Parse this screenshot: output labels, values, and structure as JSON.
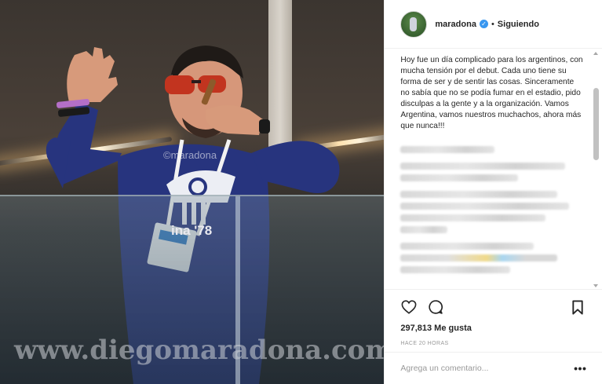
{
  "post": {
    "photo": {
      "alt": "",
      "watermark_handle": "©maradona",
      "watermark_site": "www.diegomaradona.com",
      "shirt_text": "ina '78"
    },
    "header": {
      "username": "maradona",
      "verified_icon": "verified-badge-icon",
      "separator": "•",
      "follow_status": "Siguiendo"
    },
    "caption": "Hoy fue un día complicado para los argentinos, con mucha tensión por el debut. Cada uno tiene su forma de ser y de sentir las cosas. Sinceramente no sabía que no se podía fumar en el estadio, pido disculpas a la gente y a la organización. Vamos Argentina, vamos nuestros muchachos, ahora más que nunca!!!",
    "actions": {
      "like_icon": "heart-icon",
      "comment_icon": "comment-bubble-icon",
      "save_icon": "bookmark-icon"
    },
    "likes_text": "297,813 Me gusta",
    "timestamp": "HACE 20 HORAS",
    "comment_box": {
      "placeholder": "Agrega un comentario...",
      "more_label": "•••"
    },
    "colors": {
      "verified": "#3897f0",
      "text": "#262626",
      "muted": "#999999",
      "border": "#efefef"
    }
  }
}
